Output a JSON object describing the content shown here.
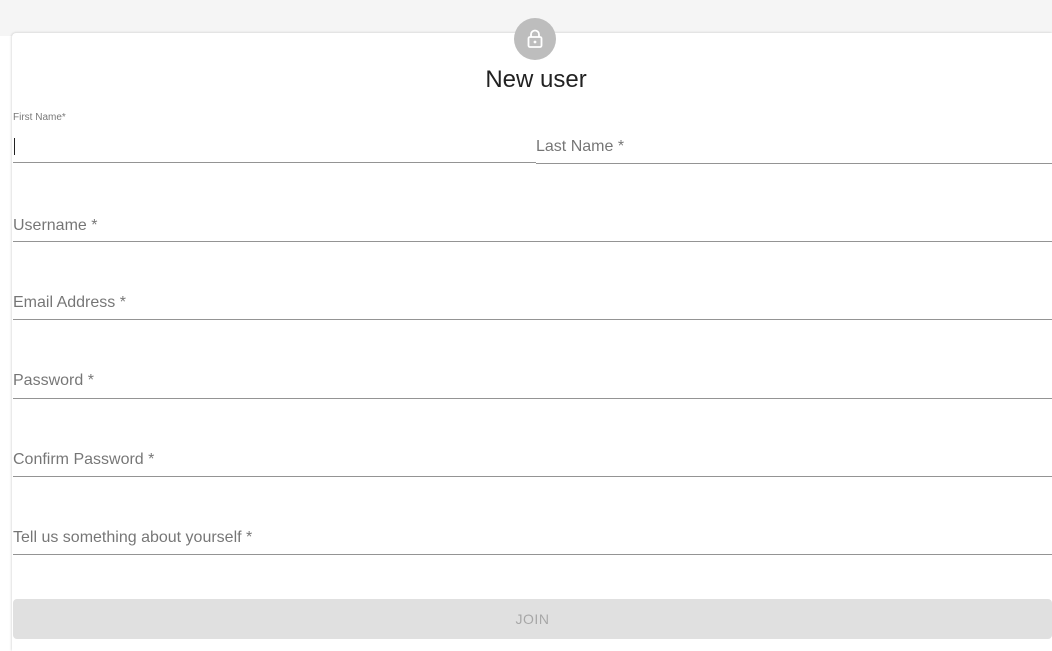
{
  "form": {
    "title": "New user",
    "icon": "lock-icon",
    "first_name": {
      "label": "First Name",
      "required": "*",
      "value": ""
    },
    "last_name": {
      "label": "Last Name",
      "required": "*"
    },
    "username": {
      "label": "Username",
      "required": "*"
    },
    "email": {
      "label": "Email Address",
      "required": "*"
    },
    "password": {
      "label": "Password",
      "required": "*"
    },
    "confirm_password": {
      "label": "Confirm Password",
      "required": "*"
    },
    "about": {
      "label": "Tell us something about yourself",
      "required": "*"
    },
    "join_label": "JOIN"
  },
  "colors": {
    "avatar_bg": "#bdbdbd",
    "button_bg": "#e0e0e0",
    "page_top_bg": "#f5f5f5"
  }
}
